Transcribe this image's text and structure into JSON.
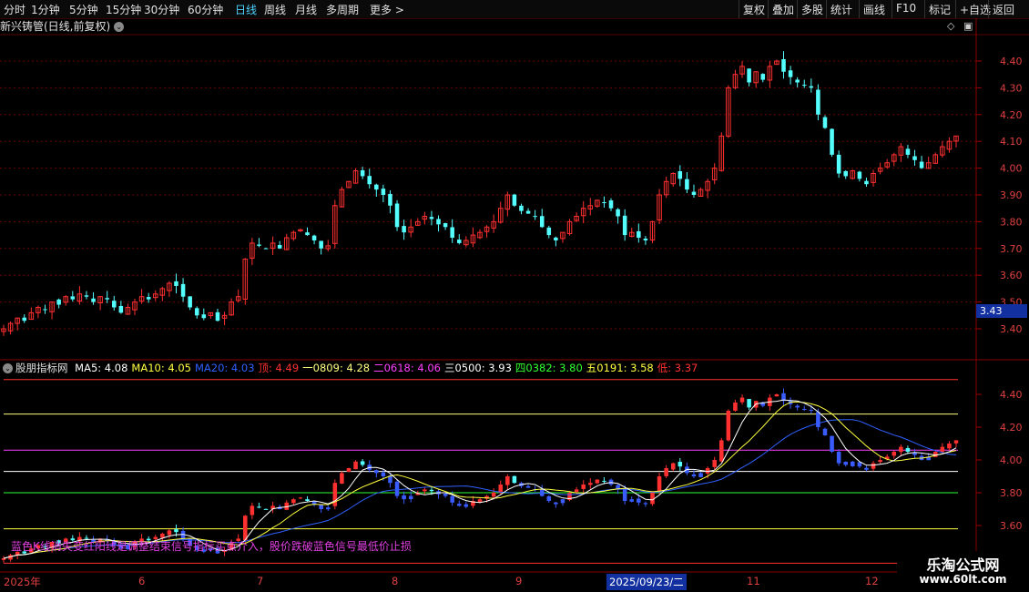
{
  "toolbar": {
    "left_items": [
      "分时",
      "1分钟",
      "5分钟",
      "15分钟",
      "30分钟",
      "60分钟",
      "日线",
      "周线",
      "月线",
      "多周期",
      "更多 >"
    ],
    "active_item": "日线",
    "right_items": [
      "复权",
      "叠加",
      "多股",
      "统计",
      "画线",
      "F10",
      "标记",
      "+自选",
      "返回"
    ]
  },
  "main_chart": {
    "title": "新兴铸管(日线,前复权)",
    "y_ticks": [
      "4.40",
      "4.30",
      "4.20",
      "4.10",
      "4.00",
      "3.90",
      "3.80",
      "3.70",
      "3.60",
      "3.50",
      "3.40"
    ],
    "y_values": [
      4.4,
      4.3,
      4.2,
      4.1,
      4.0,
      3.9,
      3.8,
      3.7,
      3.6,
      3.5,
      3.4
    ],
    "current_price": "3.43"
  },
  "indicator": {
    "name": "股朋指标网",
    "labels": [
      {
        "text": "MA5: 4.08",
        "color": "#ffffff"
      },
      {
        "text": "MA10: 4.05",
        "color": "#ffff40"
      },
      {
        "text": "MA20: 4.03",
        "color": "#3060ff"
      },
      {
        "text": "顶: 4.49",
        "color": "#ff3030"
      },
      {
        "text": "一0809: 4.28",
        "color": "#ffff80"
      },
      {
        "text": "二0618: 4.06",
        "color": "#ff40ff"
      },
      {
        "text": "三0500: 3.93",
        "color": "#ffffff"
      },
      {
        "text": "四0382: 3.80",
        "color": "#30ff30"
      },
      {
        "text": "五0191: 3.58",
        "color": "#ffff40"
      },
      {
        "text": "低: 3.37",
        "color": "#ff3030"
      }
    ],
    "y_ticks": [
      "4.40",
      "4.20",
      "4.00",
      "3.80",
      "3.60"
    ],
    "levels": [
      {
        "name": "顶",
        "value": 4.49,
        "color": "#ff3030"
      },
      {
        "name": "一0809",
        "value": 4.28,
        "color": "#ffff80"
      },
      {
        "name": "二0618",
        "value": 4.06,
        "color": "#ff40ff"
      },
      {
        "name": "三0500",
        "value": 3.93,
        "color": "#ffffff"
      },
      {
        "name": "四0382",
        "value": 3.8,
        "color": "#30ff30"
      },
      {
        "name": "五0191",
        "value": 3.58,
        "color": "#ffff40"
      },
      {
        "name": "低",
        "value": 3.37,
        "color": "#ff3030"
      }
    ],
    "note": "蓝色K线消失变红阳线是调整结束信号指标买点介入，股价跌破蓝色信号最低价止损"
  },
  "date_axis": {
    "labels": [
      "2025年",
      "6",
      "7",
      "8",
      "9",
      "11",
      "12"
    ],
    "cursor_date": "2025/09/23/二"
  },
  "watermark": {
    "line1": "乐淘公式网",
    "line2": "www.60lt.com"
  },
  "chart_data": {
    "type": "candlestick",
    "title": "新兴铸管(日线,前复权)",
    "ylim": [
      3.35,
      4.5
    ],
    "close": [
      3.4,
      3.42,
      3.44,
      3.43,
      3.46,
      3.48,
      3.47,
      3.5,
      3.49,
      3.52,
      3.51,
      3.53,
      3.52,
      3.5,
      3.52,
      3.51,
      3.48,
      3.46,
      3.48,
      3.5,
      3.52,
      3.51,
      3.53,
      3.55,
      3.57,
      3.56,
      3.52,
      3.48,
      3.45,
      3.44,
      3.46,
      3.43,
      3.45,
      3.5,
      3.52,
      3.66,
      3.72,
      3.71,
      3.7,
      3.72,
      3.7,
      3.74,
      3.76,
      3.77,
      3.75,
      3.73,
      3.7,
      3.71,
      3.86,
      3.92,
      3.95,
      3.99,
      3.97,
      3.94,
      3.92,
      3.9,
      3.86,
      3.78,
      3.76,
      3.78,
      3.8,
      3.82,
      3.81,
      3.79,
      3.78,
      3.74,
      3.72,
      3.73,
      3.75,
      3.76,
      3.78,
      3.8,
      3.85,
      3.9,
      3.86,
      3.84,
      3.83,
      3.82,
      3.78,
      3.75,
      3.73,
      3.76,
      3.8,
      3.82,
      3.85,
      3.86,
      3.88,
      3.87,
      3.85,
      3.82,
      3.75,
      3.76,
      3.74,
      3.73,
      3.8,
      3.9,
      3.95,
      3.98,
      3.96,
      3.92,
      3.9,
      3.92,
      3.95,
      4.0,
      4.12,
      4.3,
      4.35,
      4.38,
      4.32,
      4.36,
      4.33,
      4.38,
      4.4,
      4.36,
      4.34,
      4.32,
      4.31,
      4.3,
      4.2,
      4.15,
      4.05,
      3.98,
      3.97,
      3.99,
      3.96,
      3.94,
      3.98,
      4.0,
      4.02,
      4.05,
      4.08,
      4.05,
      4.03,
      4.0,
      4.02,
      4.05,
      4.08,
      4.1,
      4.12
    ]
  }
}
